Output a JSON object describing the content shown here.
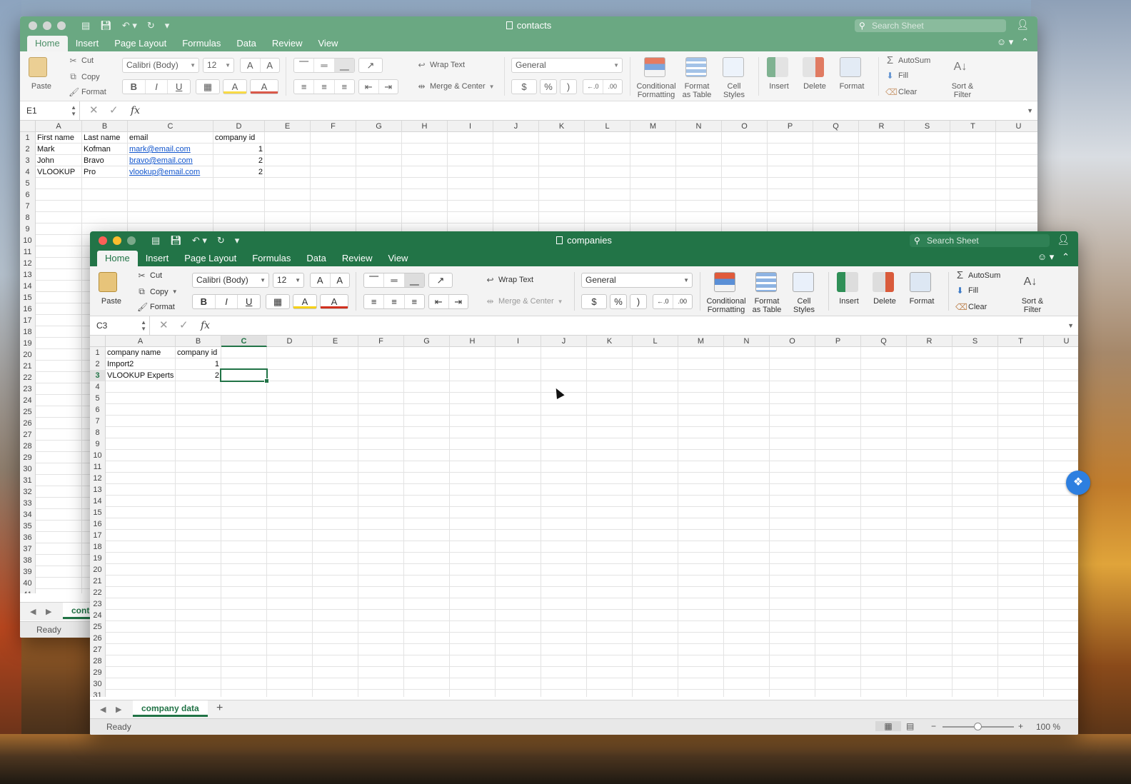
{
  "colors": {
    "accent": "#217346",
    "inactive_title": "#6aa882",
    "link": "#1155cc"
  },
  "icons": [
    "doc-icon",
    "save-icon",
    "undo-icon",
    "redo-icon",
    "search-icon",
    "add-person-icon",
    "smiley-icon",
    "cut-icon",
    "copy-icon",
    "format-painter-icon",
    "paste-icon",
    "dropbox-icon"
  ],
  "ribbon": {
    "tabs": [
      "Home",
      "Insert",
      "Page Layout",
      "Formulas",
      "Data",
      "Review",
      "View"
    ],
    "paste": "Paste",
    "cut": "Cut",
    "copy": "Copy",
    "format_painter": "Format",
    "font_name": "Calibri (Body)",
    "font_size": "12",
    "grow": "A",
    "shrink": "A",
    "bold": "B",
    "italic": "I",
    "underline": "U",
    "fill": "A",
    "font_color": "A",
    "wrap_text": "Wrap Text",
    "merge_center": "Merge & Center",
    "number_format": "General",
    "currency": "$",
    "percent": "%",
    "comma": ")",
    "inc_decimal": "←.0\n.00",
    "dec_decimal": ".00\n→.0",
    "conditional_formatting": [
      "Conditional",
      "Formatting"
    ],
    "format_as_table": [
      "Format",
      "as Table"
    ],
    "cell_styles": [
      "Cell",
      "Styles"
    ],
    "insert": "Insert",
    "delete": "Delete",
    "format": "Format",
    "autosum": "AutoSum",
    "fill_cmd": "Fill",
    "clear": "Clear",
    "sort_filter": [
      "Sort &",
      "Filter"
    ]
  },
  "back_window": {
    "title": "contacts",
    "search_placeholder": "Search Sheet",
    "name_box": "E1",
    "columns": [
      "A",
      "B",
      "C",
      "D",
      "E",
      "F",
      "G",
      "H",
      "I",
      "J",
      "K",
      "L",
      "M",
      "N",
      "O",
      "P",
      "Q",
      "R",
      "S",
      "T",
      "U"
    ],
    "rows_visible": 41,
    "cells": [
      [
        "First name",
        "Last name",
        "email",
        "company id"
      ],
      [
        "Mark",
        "Kofman",
        "mark@email.com",
        "1"
      ],
      [
        "John",
        "Bravo",
        "bravo@email.com",
        "2"
      ],
      [
        "VLOOKUP",
        "Pro",
        "vlookup@email.com",
        "2"
      ]
    ],
    "sheet_tab": "cont",
    "status": "Ready"
  },
  "front_window": {
    "title": "companies",
    "search_placeholder": "Search Sheet",
    "name_box": "C3",
    "fx": "fx",
    "columns": [
      "A",
      "B",
      "C",
      "D",
      "E",
      "F",
      "G",
      "H",
      "I",
      "J",
      "K",
      "L",
      "M",
      "N",
      "O",
      "P",
      "Q",
      "R",
      "S",
      "T",
      "U"
    ],
    "rows_visible": 31,
    "cells": [
      [
        "company name",
        "company id"
      ],
      [
        "Import2",
        "1"
      ],
      [
        "VLOOKUP Experts",
        "2"
      ]
    ],
    "selected_cell": "C3",
    "sheet_tab": "company data",
    "add_sheet": "+",
    "status": "Ready",
    "zoom": "100 %",
    "zoom_minus": "−",
    "zoom_plus": "+"
  }
}
